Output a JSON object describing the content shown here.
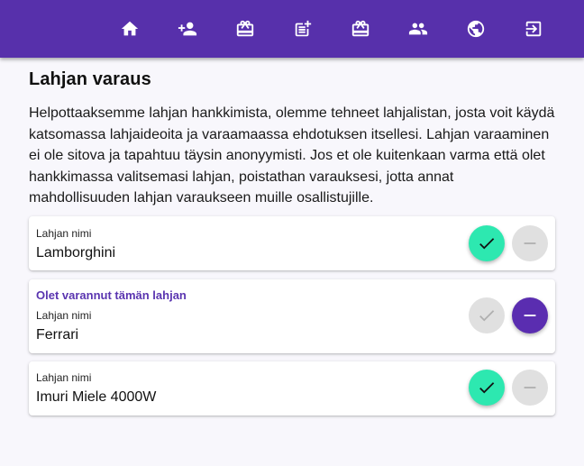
{
  "nav": [
    {
      "icon": "home-icon"
    },
    {
      "icon": "add-person-icon"
    },
    {
      "icon": "gift-icon"
    },
    {
      "icon": "post-add-icon"
    },
    {
      "icon": "gift-reserved-icon"
    },
    {
      "icon": "group-icon"
    },
    {
      "icon": "face-icon"
    },
    {
      "icon": "logout-icon"
    }
  ],
  "page": {
    "title": "Lahjan varaus",
    "intro": "Helpottaaksemme lahjan hankkimista, olemme tehneet lahjalistan, josta voit käydä katsomassa lahjaideoita ja varaamaassa ehdotuksen itsellesi. Lahjan varaaminen ei ole sitova ja tapahtuu täysin anonyymisti. Jos et ole kuitenkaan varma että olet hankkimassa valitsemasi lahjan, poistathan varauksesi, jotta annat mahdollisuuden lahjan varaukseen muille osallistujille."
  },
  "gifts": [
    {
      "status": "",
      "label": "Lahjan nimi",
      "name": "Lamborghini",
      "reserved": false
    },
    {
      "status": "Olet varannut tämän lahjan",
      "label": "Lahjan nimi",
      "name": "Ferrari",
      "reserved": true
    },
    {
      "status": "",
      "label": "Lahjan nimi",
      "name": "Imuri Miele 4000W",
      "reserved": false
    }
  ],
  "colors": {
    "primary": "#5730ab",
    "accent": "#2de8b0",
    "disabled": "#e0e0e0"
  }
}
